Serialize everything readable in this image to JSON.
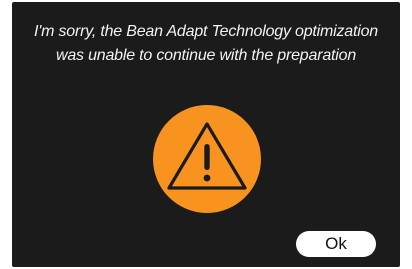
{
  "dialog": {
    "message_line1": "I'm sorry, the Bean Adapt Technology optimization",
    "message_line2": "was unable to continue with the preparation",
    "icon": "warning-icon",
    "ok_label": "Ok"
  },
  "colors": {
    "background": "#1b1b1b",
    "accent": "#f7931e",
    "text": "#f2f2f2",
    "button_bg": "#ffffff"
  }
}
